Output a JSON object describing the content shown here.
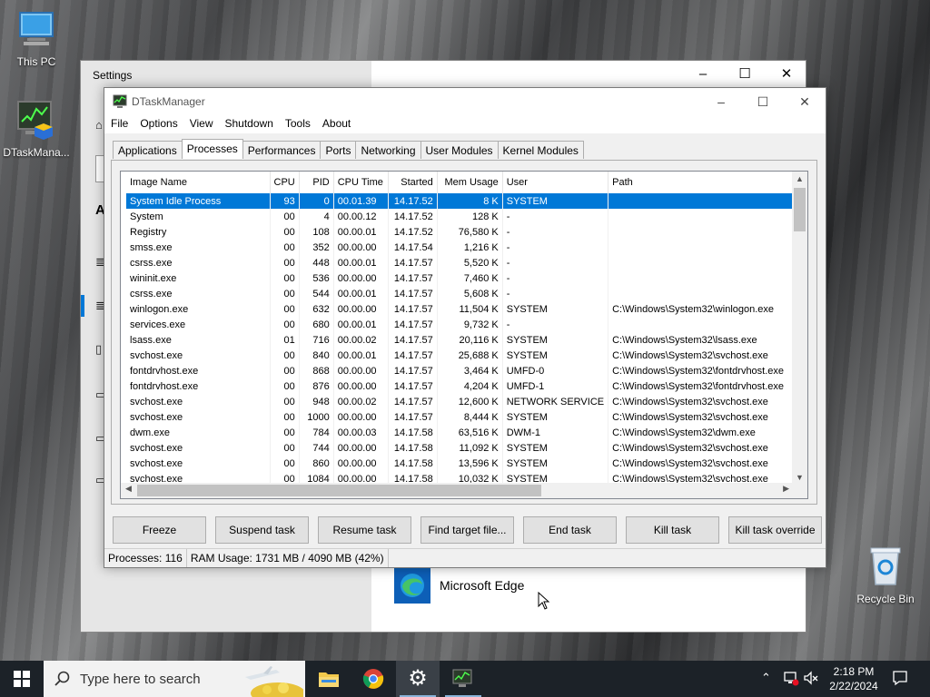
{
  "desktop": {
    "icons": [
      {
        "label": "This PC"
      },
      {
        "label": "DTaskMana..."
      },
      {
        "label": "Recycle Bin"
      }
    ]
  },
  "settings_window": {
    "title": "Settings",
    "partial_heading": "A",
    "edge_app_label": "Microsoft Edge"
  },
  "dtask": {
    "title": "DTaskManager",
    "menu": [
      "File",
      "Options",
      "View",
      "Shutdown",
      "Tools",
      "About"
    ],
    "tabs": [
      "Applications",
      "Processes",
      "Performances",
      "Ports",
      "Networking",
      "User Modules",
      "Kernel Modules"
    ],
    "active_tab": "Processes",
    "columns": [
      "Image Name",
      "CPU",
      "PID",
      "CPU Time",
      "Started",
      "Mem Usage",
      "User",
      "Path"
    ],
    "rows": [
      [
        "System Idle Process",
        "93",
        "0",
        "00.01.39",
        "14.17.52",
        "8 K",
        "SYSTEM",
        ""
      ],
      [
        "System",
        "00",
        "4",
        "00.00.12",
        "14.17.52",
        "128 K",
        "-",
        ""
      ],
      [
        "Registry",
        "00",
        "108",
        "00.00.01",
        "14.17.52",
        "76,580 K",
        "-",
        ""
      ],
      [
        "smss.exe",
        "00",
        "352",
        "00.00.00",
        "14.17.54",
        "1,216 K",
        "-",
        ""
      ],
      [
        "csrss.exe",
        "00",
        "448",
        "00.00.01",
        "14.17.57",
        "5,520 K",
        "-",
        ""
      ],
      [
        "wininit.exe",
        "00",
        "536",
        "00.00.00",
        "14.17.57",
        "7,460 K",
        "-",
        ""
      ],
      [
        "csrss.exe",
        "00",
        "544",
        "00.00.01",
        "14.17.57",
        "5,608 K",
        "-",
        ""
      ],
      [
        "winlogon.exe",
        "00",
        "632",
        "00.00.00",
        "14.17.57",
        "11,504 K",
        "SYSTEM",
        "C:\\Windows\\System32\\winlogon.exe"
      ],
      [
        "services.exe",
        "00",
        "680",
        "00.00.01",
        "14.17.57",
        "9,732 K",
        "-",
        ""
      ],
      [
        "lsass.exe",
        "01",
        "716",
        "00.00.02",
        "14.17.57",
        "20,116 K",
        "SYSTEM",
        "C:\\Windows\\System32\\lsass.exe"
      ],
      [
        "svchost.exe",
        "00",
        "840",
        "00.00.01",
        "14.17.57",
        "25,688 K",
        "SYSTEM",
        "C:\\Windows\\System32\\svchost.exe"
      ],
      [
        "fontdrvhost.exe",
        "00",
        "868",
        "00.00.00",
        "14.17.57",
        "3,464 K",
        "UMFD-0",
        "C:\\Windows\\System32\\fontdrvhost.exe"
      ],
      [
        "fontdrvhost.exe",
        "00",
        "876",
        "00.00.00",
        "14.17.57",
        "4,204 K",
        "UMFD-1",
        "C:\\Windows\\System32\\fontdrvhost.exe"
      ],
      [
        "svchost.exe",
        "00",
        "948",
        "00.00.02",
        "14.17.57",
        "12,600 K",
        "NETWORK SERVICE",
        "C:\\Windows\\System32\\svchost.exe"
      ],
      [
        "svchost.exe",
        "00",
        "1000",
        "00.00.00",
        "14.17.57",
        "8,444 K",
        "SYSTEM",
        "C:\\Windows\\System32\\svchost.exe"
      ],
      [
        "dwm.exe",
        "00",
        "784",
        "00.00.03",
        "14.17.58",
        "63,516 K",
        "DWM-1",
        "C:\\Windows\\System32\\dwm.exe"
      ],
      [
        "svchost.exe",
        "00",
        "744",
        "00.00.00",
        "14.17.58",
        "11,092 K",
        "SYSTEM",
        "C:\\Windows\\System32\\svchost.exe"
      ],
      [
        "svchost.exe",
        "00",
        "860",
        "00.00.00",
        "14.17.58",
        "13,596 K",
        "SYSTEM",
        "C:\\Windows\\System32\\svchost.exe"
      ],
      [
        "svchost.exe",
        "00",
        "1084",
        "00.00.00",
        "14.17.58",
        "10,032 K",
        "SYSTEM",
        "C:\\Windows\\System32\\svchost.exe"
      ]
    ],
    "selected_row": 0,
    "buttons": [
      "Freeze",
      "Suspend task",
      "Resume task",
      "Find target file...",
      "End task",
      "Kill task",
      "Kill task override"
    ],
    "status": {
      "processes": "Processes: 116",
      "ram": "RAM Usage:  1731 MB / 4090 MB (42%)"
    }
  },
  "taskbar": {
    "search_placeholder": "Type here to search",
    "time": "2:18 PM",
    "date": "2/22/2024"
  },
  "colors": {
    "selection": "#0078d7",
    "taskbar": "#1c2228",
    "window_bg": "#f0f0f0"
  }
}
